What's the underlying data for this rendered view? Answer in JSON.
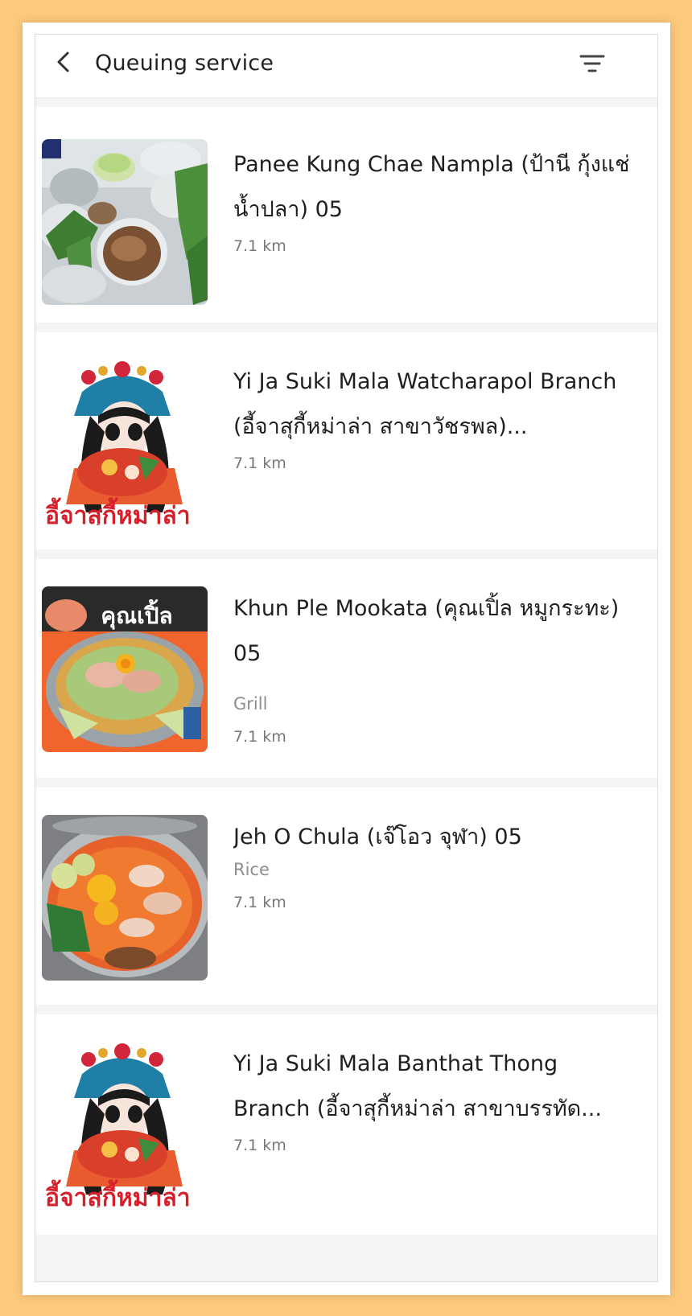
{
  "header": {
    "title": "Queuing service"
  },
  "restaurants": [
    {
      "name": "Panee Kung Chae Nampla (ป้านี กุ้งแช่น้ำปลา) 05",
      "category": "",
      "distance": "7.1 km"
    },
    {
      "name": "Yi Ja Suki Mala Watcharapol Branch (อี้จาสุกี้หม่าล่า สาขาวัชรพล)...",
      "category": "",
      "distance": "7.1 km",
      "image_text": "อี้จาสุกี้หม่าล่า"
    },
    {
      "name": "Khun Ple Mookata (คุณเปิ้ล หมูกระทะ) 05",
      "category": "Grill",
      "distance": "7.1 km",
      "image_text": "คุณเปิ้ล"
    },
    {
      "name": "Jeh O Chula (เจ๊โอว จุฬา) 05",
      "category": "Rice",
      "distance": "7.1 km"
    },
    {
      "name": "Yi Ja Suki Mala Banthat Thong Branch (อี้จาสุกี้หม่าล่า สาขาบรรทัด...",
      "category": "",
      "distance": "7.1 km",
      "image_text": "อี้จาสุกี้หม่าล่า"
    }
  ],
  "colors": {
    "page_background": "#fcc97d",
    "screen_background": "#f4f4f6",
    "title_text": "#1f1f1f",
    "secondary_text": "#8d8d8d"
  },
  "icons": {
    "back": "chevron-left-icon",
    "filter": "filter-icon"
  }
}
